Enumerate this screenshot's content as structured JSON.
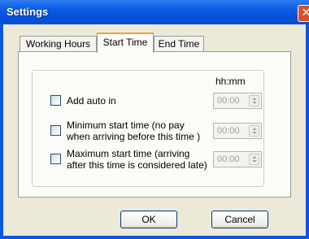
{
  "window": {
    "title": "Settings",
    "close_glyph": "✕"
  },
  "tabs": [
    {
      "label": "Working Hours",
      "active": false
    },
    {
      "label": "Start Time",
      "active": true
    },
    {
      "label": "End Time",
      "active": false
    }
  ],
  "start_time": {
    "column_header": "hh:mm",
    "options": [
      {
        "label_lines": [
          "Add auto in"
        ],
        "checked": false,
        "time": "00:00"
      },
      {
        "label_lines": [
          "Minimum start time (no pay",
          "when arriving before this time )"
        ],
        "checked": false,
        "time": "00:00"
      },
      {
        "label_lines": [
          "Maximum start time (arriving",
          "after this time is considered late)"
        ],
        "checked": false,
        "time": "00:00"
      }
    ]
  },
  "buttons": {
    "ok": "OK",
    "cancel": "Cancel"
  }
}
